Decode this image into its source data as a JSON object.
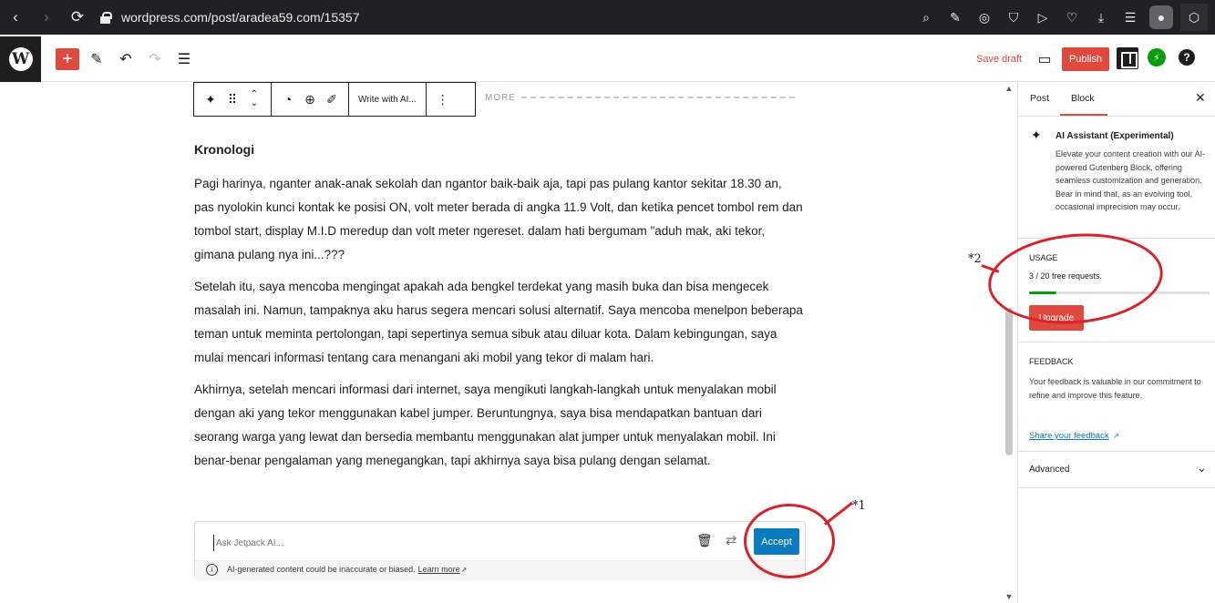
{
  "browser": {
    "url": "wordpress.com/post/aradea59.com/15357",
    "back_icon": "‹",
    "forward_icon": "›",
    "reload_icon": "⟳"
  },
  "toolbar": {
    "add_icon": "+",
    "save_draft": "Save draft",
    "publish": "Publish",
    "help_icon": "?"
  },
  "block_toolbar": {
    "write_with_ai": "Write with AI...",
    "more_label": "MORE"
  },
  "content": {
    "heading": "Kronologi",
    "paragraphs": [
      "Pagi harinya, nganter anak-anak sekolah dan ngantor baik-baik aja, tapi pas pulang kantor sekitar 18.30 an, pas nyolokin kunci kontak ke posisi ON, volt meter berada di angka 11.9 Volt, dan ketika pencet tombol rem dan tombol start, display M.I.D meredup dan volt meter ngereset. dalam hati bergumam \"aduh mak, aki tekor, gimana pulang nya ini...???",
      "Setelah itu, saya mencoba mengingat apakah ada bengkel terdekat yang masih buka dan bisa mengecek masalah ini. Namun, tampaknya aku harus segera mencari solusi alternatif. Saya mencoba menelpon beberapa teman untuk meminta pertolongan, tapi sepertinya semua sibuk atau diluar kota. Dalam kebingungan, saya mulai mencari informasi tentang cara menangani aki mobil yang tekor di malam hari.",
      "Akhirnya, setelah mencari informasi dari internet, saya mengikuti langkah-langkah untuk menyalakan mobil dengan aki yang tekor menggunakan kabel jumper. Beruntungnya, saya bisa mendapatkan bantuan dari seorang warga yang lewat dan bersedia membantu menggunakan alat jumper untuk menyalakan mobil. Ini benar-benar pengalaman yang menegangkan, tapi akhirnya saya bisa pulang dengan selamat."
    ]
  },
  "ai_box": {
    "placeholder": "Ask Jetpack AI...",
    "accept": "Accept",
    "disclaimer": "AI-generated content could be inaccurate or biased.",
    "learn_more": "Learn more"
  },
  "annotations": {
    "label1": "*1",
    "label2": "*2",
    "color": "#d9232a"
  },
  "sidebar": {
    "tabs": [
      "Post",
      "Block"
    ],
    "active_tab": "Block",
    "ai_title": "AI Assistant (Experimental)",
    "ai_description": "Elevate your content creation with our AI-powered Gutenberg Block, offering seamless customization and generation. Bear in mind that, as an evolving tool, occasional imprecision may occur.",
    "usage_heading": "USAGE",
    "usage_text": "3 / 20 free requests.",
    "usage_fraction": 0.15,
    "upgrade": "Upgrade",
    "feedback_heading": "FEEDBACK",
    "feedback_text": "Your feedback is valuable in our commitment to refine and improve this feature.",
    "share_feedback": "Share your feedback",
    "advanced": "Advanced"
  },
  "colors": {
    "brand_red": "#e04a3c",
    "accept_blue": "#0a7bbf",
    "jetpack_green": "#069e08"
  }
}
